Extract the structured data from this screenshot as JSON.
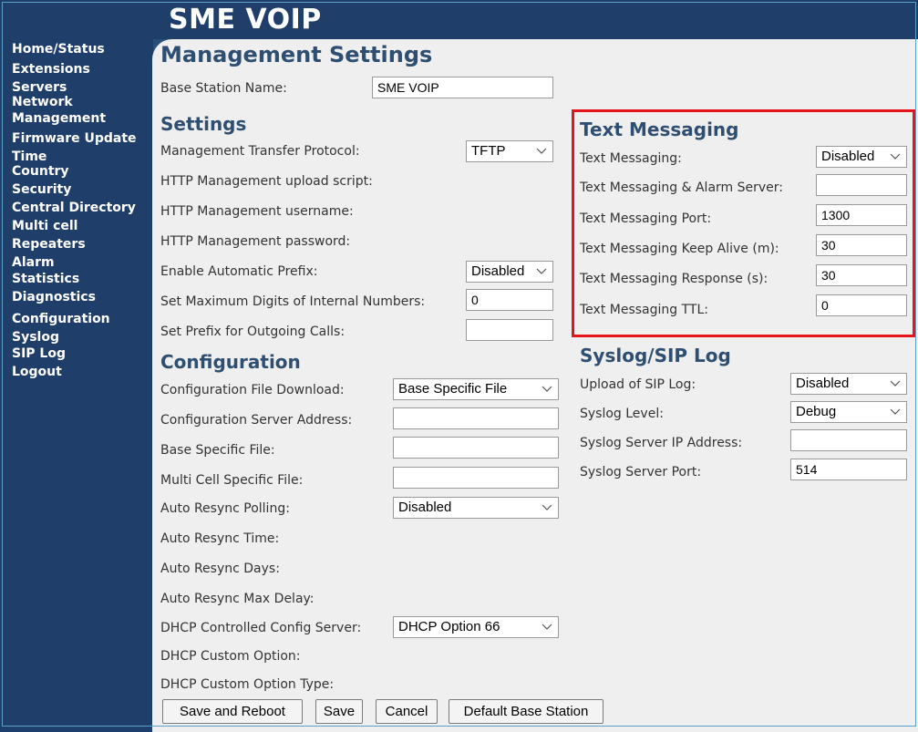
{
  "app_title": "SME VOIP",
  "sidebar": {
    "items": [
      "Home/Status",
      "Extensions",
      "Servers",
      "Network",
      "Management",
      "Firmware Update",
      "Time",
      "Country",
      "Security",
      "Central Directory",
      "Multi cell",
      "Repeaters",
      "Alarm",
      "Statistics",
      "Diagnostics",
      "Configuration",
      "Syslog",
      "SIP Log",
      "Logout"
    ]
  },
  "page_title": "Management Settings",
  "base_station": {
    "label": "Base Station Name:",
    "value": "SME VOIP"
  },
  "settings": {
    "heading": "Settings",
    "transfer_protocol": {
      "label": "Management Transfer Protocol:",
      "value": "TFTP"
    },
    "upload_script": {
      "label": "HTTP Management upload script:"
    },
    "username": {
      "label": "HTTP Management username:"
    },
    "password": {
      "label": "HTTP Management password:"
    },
    "auto_prefix": {
      "label": "Enable Automatic Prefix:",
      "value": "Disabled"
    },
    "max_digits": {
      "label": "Set Maximum Digits of Internal Numbers:",
      "value": "0"
    },
    "prefix_outgoing": {
      "label": "Set Prefix for Outgoing Calls:",
      "value": ""
    }
  },
  "configuration": {
    "heading": "Configuration",
    "file_download": {
      "label": "Configuration File Download:",
      "value": "Base Specific File"
    },
    "server_address": {
      "label": "Configuration Server Address:",
      "value": ""
    },
    "base_specific_file": {
      "label": "Base Specific File:",
      "value": ""
    },
    "multi_cell_file": {
      "label": "Multi Cell Specific File:",
      "value": ""
    },
    "resync_polling": {
      "label": "Auto Resync Polling:",
      "value": "Disabled"
    },
    "resync_time": {
      "label": "Auto Resync Time:"
    },
    "resync_days": {
      "label": "Auto Resync Days:"
    },
    "resync_max_delay": {
      "label": "Auto Resync Max Delay:"
    },
    "dhcp_config_server": {
      "label": "DHCP Controlled Config Server:",
      "value": "DHCP Option 66"
    },
    "dhcp_custom_option": {
      "label": "DHCP Custom Option:"
    },
    "dhcp_custom_option_type": {
      "label": "DHCP Custom Option Type:"
    }
  },
  "text_messaging": {
    "heading": "Text Messaging",
    "enabled": {
      "label": "Text Messaging:",
      "value": "Disabled"
    },
    "alarm_server": {
      "label": "Text Messaging & Alarm Server:",
      "value": ""
    },
    "port": {
      "label": "Text Messaging Port:",
      "value": "1300"
    },
    "keep_alive": {
      "label": "Text Messaging Keep Alive (m):",
      "value": "30"
    },
    "response": {
      "label": "Text Messaging Response (s):",
      "value": "30"
    },
    "ttl": {
      "label": "Text Messaging TTL:",
      "value": "0"
    }
  },
  "syslog": {
    "heading": "Syslog/SIP Log",
    "upload_sip_log": {
      "label": "Upload of SIP Log:",
      "value": "Disabled"
    },
    "level": {
      "label": "Syslog Level:",
      "value": "Debug"
    },
    "server_ip": {
      "label": "Syslog Server IP Address:",
      "value": ""
    },
    "server_port": {
      "label": "Syslog Server Port:",
      "value": "514"
    }
  },
  "buttons": {
    "save_reboot": "Save and Reboot",
    "save": "Save",
    "cancel": "Cancel",
    "default_base": "Default Base Station"
  },
  "colors": {
    "nav_bg": "#1f3e6a",
    "content_bg": "#efefef",
    "heading": "#2f4f72",
    "highlight": "#e8141b"
  }
}
